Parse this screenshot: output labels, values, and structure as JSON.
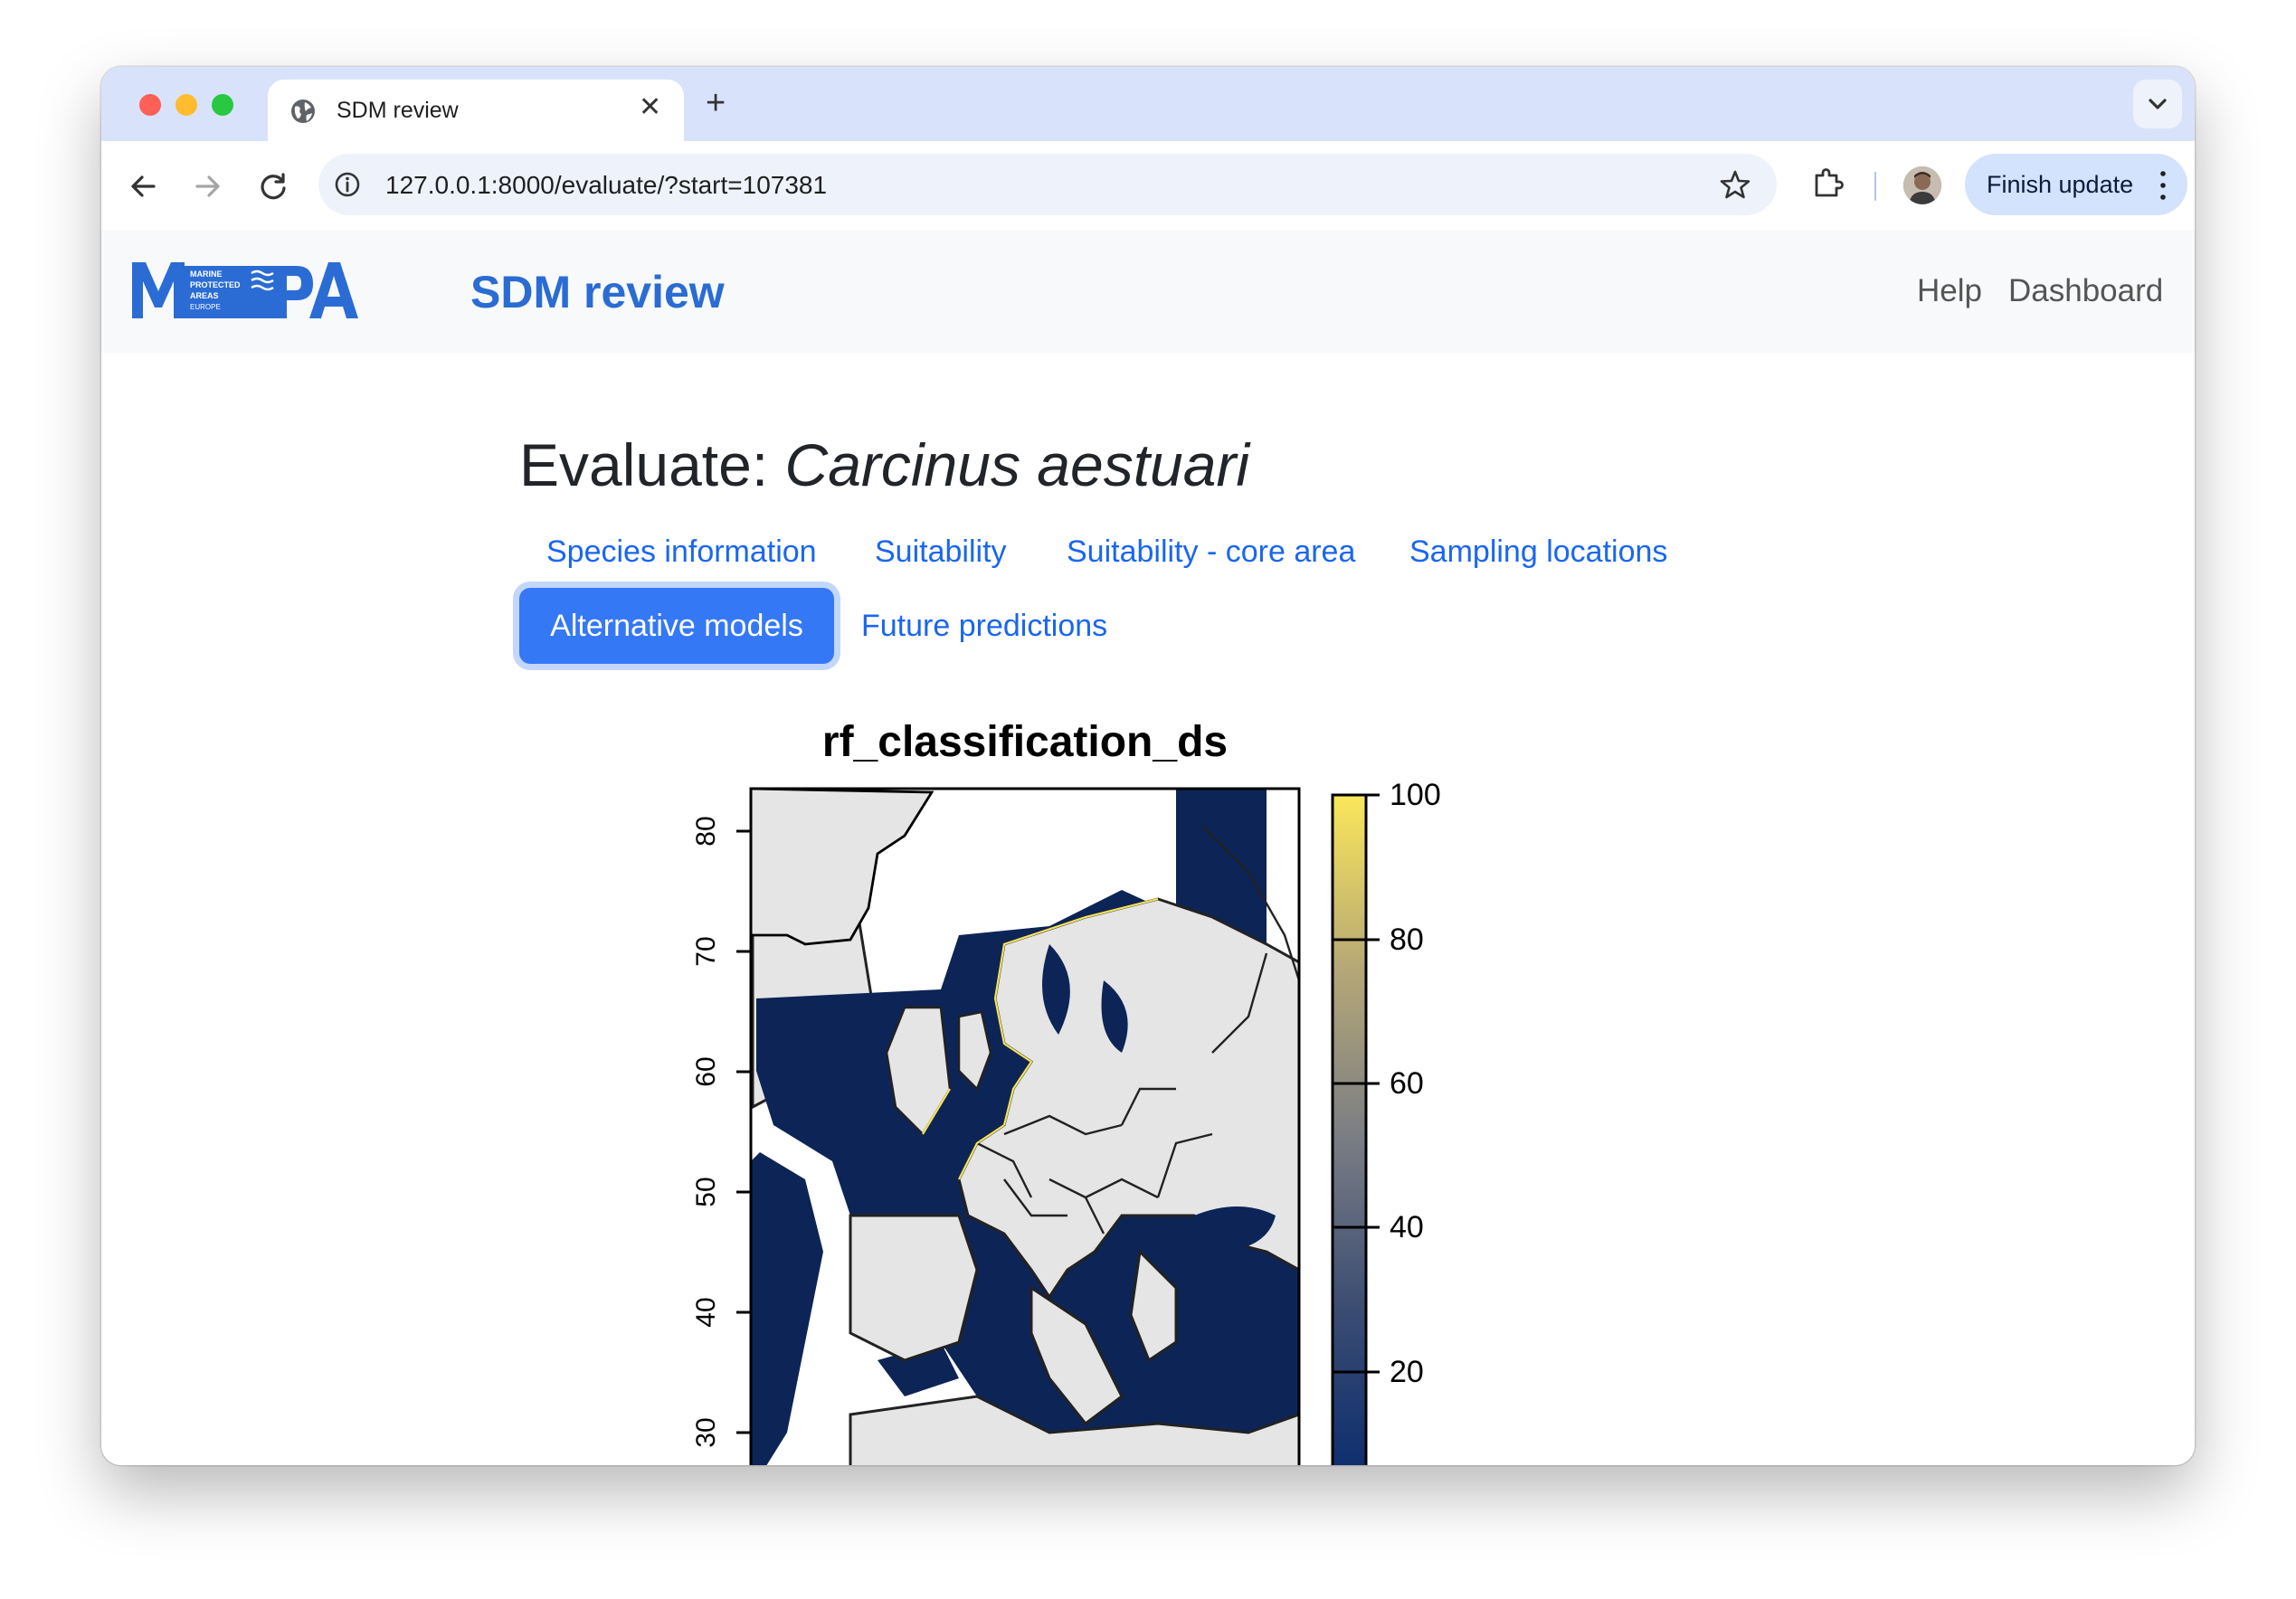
{
  "browser": {
    "tab_title": "SDM review",
    "tab_close": "✕",
    "new_tab": "+",
    "url": "127.0.0.1:8000/evaluate/?start=107381",
    "update_button": "Finish update"
  },
  "navbar": {
    "logo_text": "MPA",
    "logo_badge_lines": [
      "MARINE",
      "PROTECTED",
      "AREAS",
      "EUROPE"
    ],
    "title": "SDM review",
    "links": [
      "Help",
      "Dashboard"
    ]
  },
  "page": {
    "title_prefix": "Evaluate: ",
    "species": "Carcinus aestuari",
    "tabs": [
      {
        "label": "Species information",
        "active": false
      },
      {
        "label": "Suitability",
        "active": false
      },
      {
        "label": "Suitability - core area",
        "active": false
      },
      {
        "label": "Sampling locations",
        "active": false
      },
      {
        "label": "Alternative models",
        "active": true
      },
      {
        "label": "Future predictions",
        "active": false
      }
    ]
  },
  "map_plot": {
    "title": "rf_classification_ds",
    "y_axis_ticks": [
      "80",
      "70",
      "60",
      "50",
      "40",
      "30"
    ],
    "legend_ticks": [
      "100",
      "80",
      "60",
      "40",
      "20"
    ],
    "colors": {
      "sea": "#0d2456",
      "land": "#e5e5e5",
      "background": "#ffffff",
      "coast_highlight": "#f2e35e",
      "colorbar_top": "#fbe75a",
      "colorbar_bottom": "#0a2c6e"
    }
  },
  "colors": {
    "accent": "#3578f6",
    "link": "#1a66f0",
    "brand": "#2a6cd4",
    "tabstrip": "#d8e3fb"
  }
}
